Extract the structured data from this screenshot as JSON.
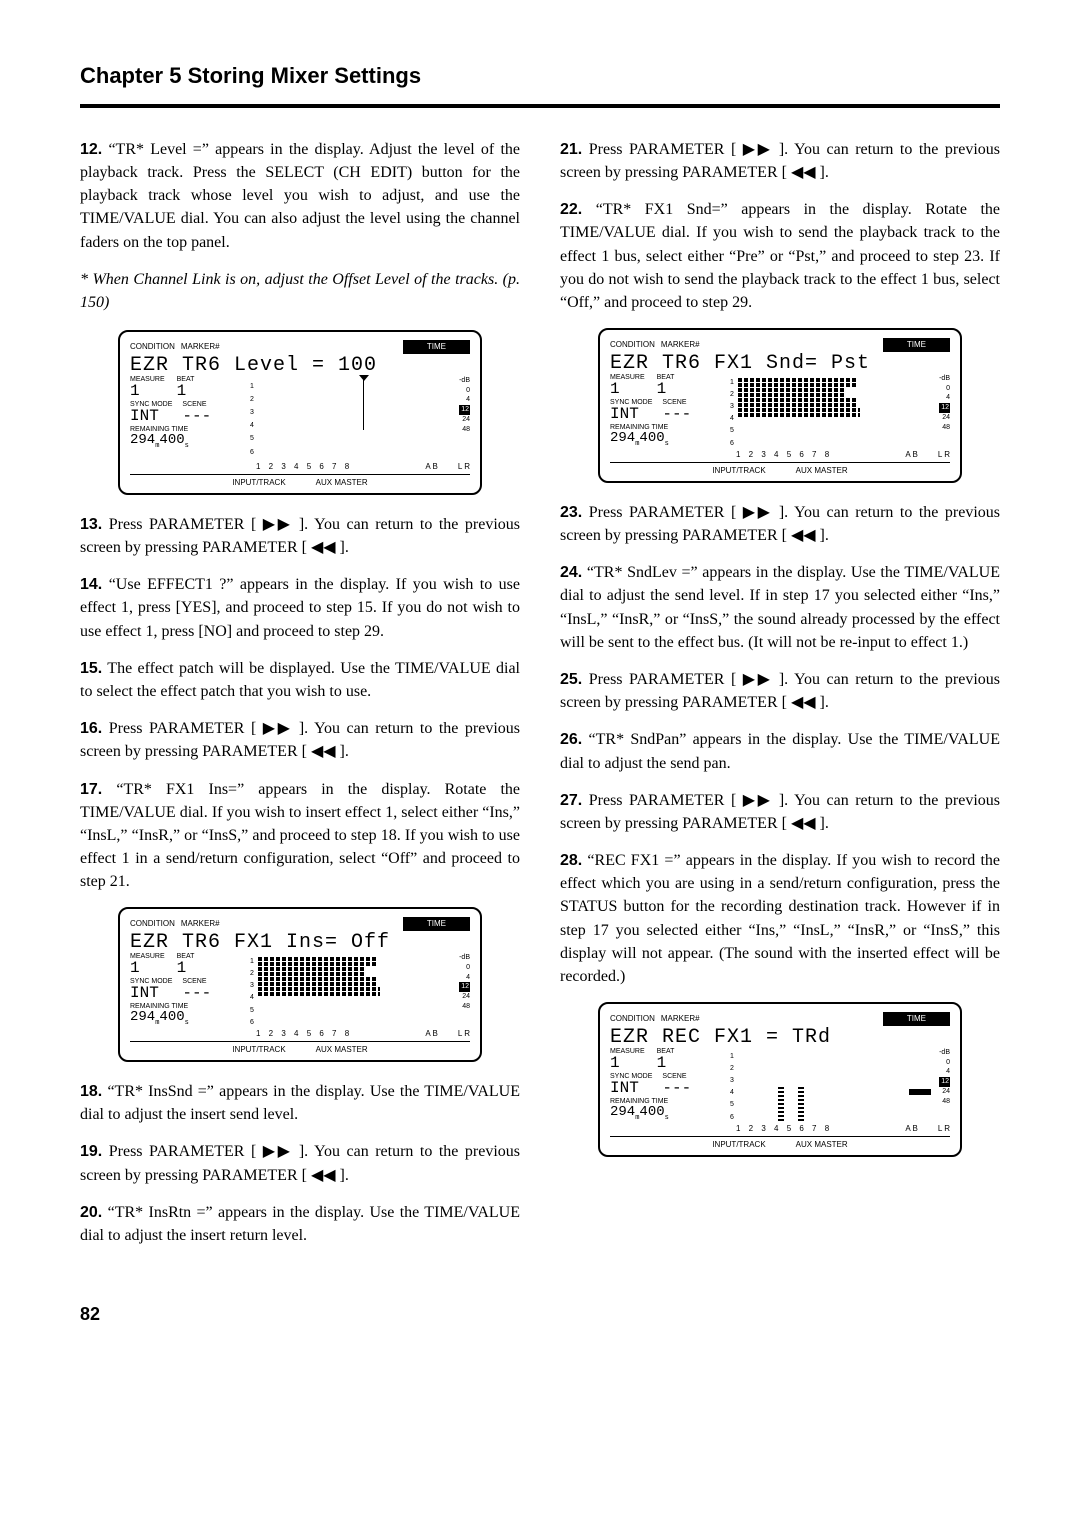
{
  "chapter": "Chapter 5 Storing Mixer Settings",
  "pagenum": "82",
  "footnote": "* When Channel Link is on, adjust the Offset Level of the tracks. (p. 150)",
  "lcd_common": {
    "condition": "CONDITION",
    "marker": "MARKER#",
    "time": "TIME",
    "measure": "MEASURE",
    "beat": "BEAT",
    "syncmode": "SYNC MODE",
    "scene": "SCENE",
    "remaining": "REMAINING TIME",
    "input_track": "INPUT/TRACK",
    "aux_master": "AUX  MASTER",
    "tracknums": "1 2 3 4 5 6 7 8",
    "ab": "A B",
    "lr": "L R",
    "db_labels": [
      "-dB",
      "0",
      "4",
      "12",
      "24",
      "48"
    ],
    "measure_val": "1",
    "beat_val": "1",
    "sync_val": "INT",
    "scene_val": "---",
    "remain_val": "294m400s"
  },
  "lcd1": {
    "main": "EZR TR6 Level = 100"
  },
  "lcd2": {
    "main": "EZR TR6 FX1 Ins= Off"
  },
  "lcd3": {
    "main": "EZR TR6 FX1 Snd= Pst"
  },
  "lcd4": {
    "main": "EZR REC FX1  =   TRd"
  },
  "steps_left": [
    {
      "n": "12.",
      "t": "“TR* Level =” appears in the display. Adjust the level of the playback track. Press the SELECT (CH EDIT) button for the playback track whose level you wish to adjust, and use the TIME/VALUE dial. You can also adjust the level using the channel faders on the top panel."
    },
    {
      "n": "13.",
      "t": "Press PARAMETER [ ▶▶ ]. You can return to the previous screen by pressing PARAMETER [ ◀◀ ]."
    },
    {
      "n": "14.",
      "t": "“Use EFFECT1 ?” appears in the display. If you wish to use effect 1, press [YES], and proceed to step 15. If you do not wish to use effect 1, press [NO] and proceed to step 29."
    },
    {
      "n": "15.",
      "t": "The effect patch will be displayed. Use the TIME/VALUE dial to select the effect patch that you wish to use."
    },
    {
      "n": "16.",
      "t": "Press PARAMETER [ ▶▶ ]. You can return to the previous screen by pressing PARAMETER [ ◀◀ ]."
    },
    {
      "n": "17.",
      "t": "“TR* FX1 Ins=” appears in the display. Rotate the TIME/VALUE dial. If you wish to insert effect 1, select either “Ins,” “InsL,” “InsR,” or “InsS,” and proceed to step 18. If you wish to use effect 1 in a send/return configuration, select “Off” and proceed to step 21."
    },
    {
      "n": "18.",
      "t": "“TR* InsSnd =” appears in the display. Use the TIME/VALUE dial to adjust the insert send level."
    },
    {
      "n": "19.",
      "t": "Press PARAMETER [ ▶▶ ]. You can return to the previous screen by pressing PARAMETER [ ◀◀ ]."
    },
    {
      "n": "20.",
      "t": "“TR* InsRtn =” appears in the display. Use the TIME/VALUE dial to adjust the insert return level."
    }
  ],
  "steps_right": [
    {
      "n": "21.",
      "t": "Press PARAMETER [ ▶▶ ]. You can return to the previous screen by pressing PARAMETER [ ◀◀ ]."
    },
    {
      "n": "22.",
      "t": "“TR* FX1 Snd=” appears in the display. Rotate the TIME/VALUE dial. If you wish to send the playback track to the effect 1 bus, select either “Pre” or “Pst,” and proceed to step 23. If you do not wish to send the playback track to the effect 1 bus, select “Off,” and proceed to step 29."
    },
    {
      "n": "23.",
      "t": "Press PARAMETER [ ▶▶ ]. You can return to the previous screen by pressing PARAMETER [ ◀◀ ]."
    },
    {
      "n": "24.",
      "t": "“TR* SndLev =” appears in the display. Use the TIME/VALUE dial to adjust the send level. If in step 17 you selected either “Ins,” “InsL,” “InsR,” or “InsS,” the sound already processed by the effect will be sent to the effect bus. (It will not be re-input to effect 1.)"
    },
    {
      "n": "25.",
      "t": "Press PARAMETER [ ▶▶ ]. You can return to the previous screen by pressing PARAMETER [ ◀◀ ]."
    },
    {
      "n": "26.",
      "t": "“TR* SndPan” appears in the display. Use the TIME/VALUE dial to adjust the send pan."
    },
    {
      "n": "27.",
      "t": "Press PARAMETER [ ▶▶ ]. You can return to the previous screen by pressing PARAMETER [ ◀◀ ]."
    },
    {
      "n": "28.",
      "t": "“REC FX1 =” appears in the display. If you wish to record the effect which you are using in a send/return configuration, press the STATUS button for the recording destination track. However if in step 17 you selected either “Ins,” “InsL,” “InsR,” or “InsS,” this display will not appear. (The sound with the inserted effect will be recorded.)"
    }
  ]
}
